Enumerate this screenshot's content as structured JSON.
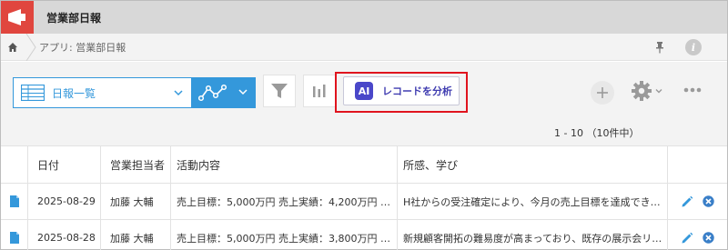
{
  "app": {
    "title": "営業部日報"
  },
  "breadcrumb": {
    "text": "アプリ: 営業部日報"
  },
  "toolbar": {
    "view_label": "日報一覧",
    "ai_badge": "AI",
    "ai_label": "レコードを分析"
  },
  "pager": {
    "text": "1 - 10 （10件中）"
  },
  "table": {
    "headers": [
      "日付",
      "営業担当者",
      "活動内容",
      "所感、学び"
    ],
    "rows": [
      {
        "date": "2025-08-29",
        "person": "加藤 大輔",
        "activity": "売上目標：5,000万円 売上実績：4,200万円 …",
        "notes": "H社からの受注確定により、今月の売上目標を達成でき…"
      },
      {
        "date": "2025-08-28",
        "person": "加藤 大輔",
        "activity": "売上目標：5,000万円 売上実績：3,800万円 …",
        "notes": "新規顧客開拓の難易度が高まっており、既存の展示会リ…"
      }
    ]
  },
  "colors": {
    "accent": "#3498db",
    "brand": "#e0463e",
    "ai": "#4a47c9",
    "highlight": "#e0141e"
  }
}
